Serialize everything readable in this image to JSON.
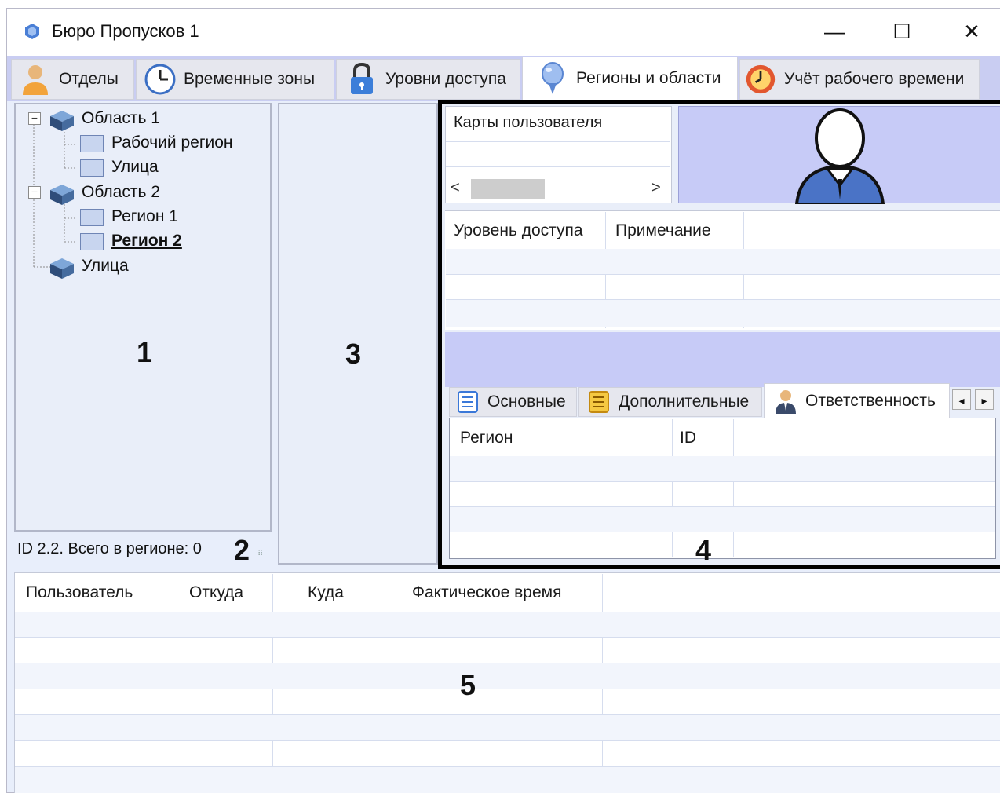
{
  "window": {
    "title": "Бюро Пропусков 1",
    "minimize_icon": "—",
    "maximize_icon": "☐",
    "close_icon": "✕"
  },
  "tabs": [
    {
      "label": "Отделы",
      "icon": "user-icon"
    },
    {
      "label": "Временные зоны",
      "icon": "clock-icon"
    },
    {
      "label": "Уровни доступа",
      "icon": "lock-icon"
    },
    {
      "label": "Регионы и области",
      "icon": "map-pin-icon",
      "active": true
    },
    {
      "label": "Учёт рабочего времени",
      "icon": "stopwatch-icon"
    }
  ],
  "tree": {
    "items": [
      {
        "label": "Область 1",
        "kind": "area"
      },
      {
        "label": "Рабочий регион",
        "kind": "region"
      },
      {
        "label": "Улица",
        "kind": "region"
      },
      {
        "label": "Область 2",
        "kind": "area"
      },
      {
        "label": "Регион 1",
        "kind": "region"
      },
      {
        "label": "Регион 2",
        "kind": "region",
        "selected": true
      },
      {
        "label": "Улица",
        "kind": "area"
      }
    ],
    "expand_symbol": "⊟"
  },
  "status": {
    "text": "ID 2.2. Всего в регионе: 0"
  },
  "user_cards": {
    "header": "Карты пользователя",
    "scroll_left": "<",
    "scroll_right": ">"
  },
  "access_table": {
    "columns": [
      "Уровень доступа",
      "Примечание"
    ]
  },
  "details_tabs": {
    "items": [
      {
        "label": "Основные",
        "icon": "list-icon"
      },
      {
        "label": "Дополнительные",
        "icon": "notes-icon"
      },
      {
        "label": "Ответственность",
        "icon": "person-icon",
        "active": true
      }
    ],
    "scroll_left": "◂",
    "scroll_right": "▸"
  },
  "region_table": {
    "columns": [
      "Регион",
      "ID"
    ]
  },
  "events_table": {
    "columns": [
      "Пользователь",
      "Откуда",
      "Куда",
      "Фактическое время"
    ]
  },
  "callouts": {
    "n1": "1",
    "n2": "2",
    "n3": "3",
    "n4": "4",
    "n5": "5"
  },
  "colors": {
    "tab_bar": "#c9cdf2",
    "panel_bg": "#e9eef9",
    "photo_bg": "#c7cbf7",
    "accent_band": "#c7cbf7"
  }
}
